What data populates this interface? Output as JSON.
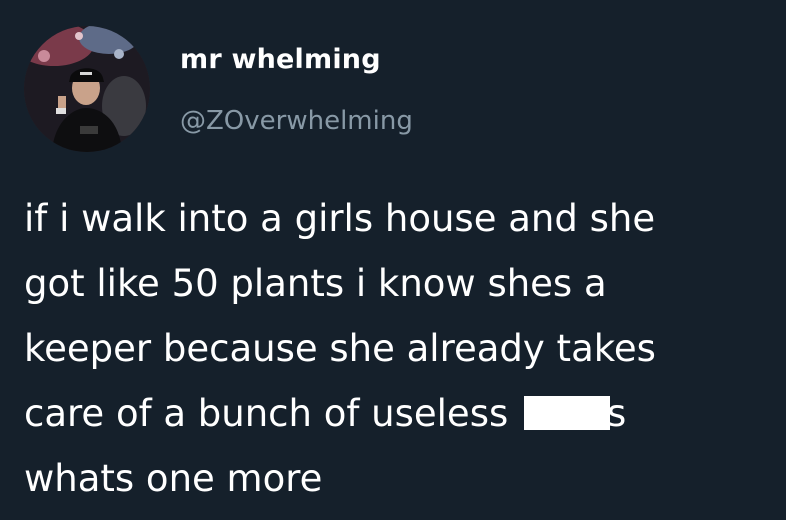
{
  "tweet": {
    "author": {
      "display_name": "mr whelming",
      "handle": "@ZOverwhelming",
      "avatar_icon": "profile-photo"
    },
    "text_lines": [
      "if i walk into a girls house and she",
      "got like 50 plants i know shes a",
      "keeper because she already takes",
      "care of a bunch of useless",
      "whats one more"
    ],
    "censored_word_tail": "s"
  },
  "colors": {
    "background": "#15202b",
    "text": "#ffffff",
    "handle": "#8899a6",
    "censor": "#ffffff"
  }
}
